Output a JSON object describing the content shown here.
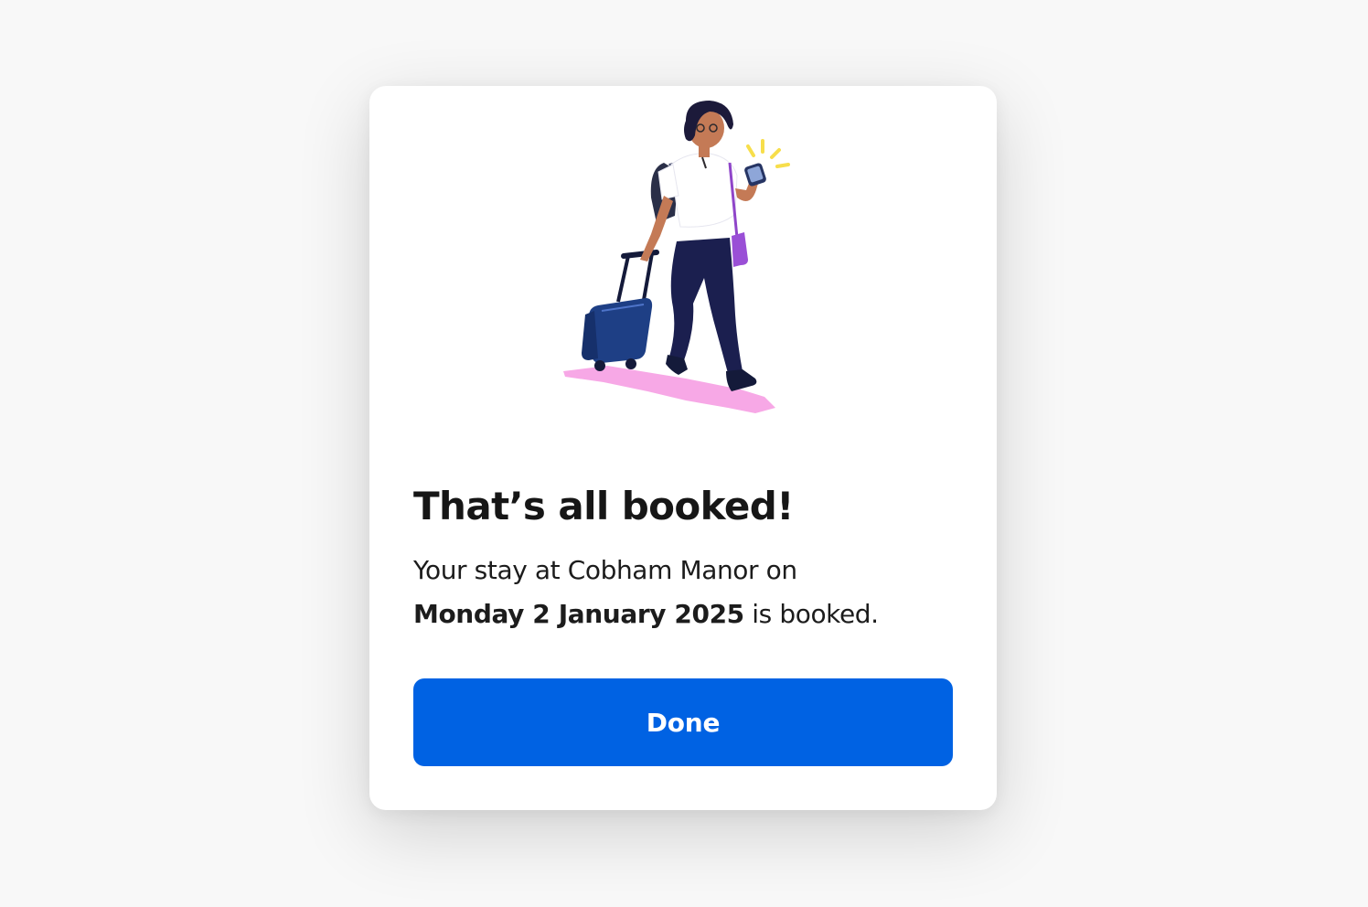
{
  "dialog": {
    "title": "That’s all booked!",
    "message_prefix": "Your stay at Cobham Manor on",
    "message_date": "Monday 2 January 2025",
    "message_suffix": " is booked.",
    "done_label": "Done",
    "illustration": "traveller-with-suitcase-illustration"
  },
  "colors": {
    "page_background": "#f8f8f8",
    "card_background": "#ffffff",
    "primary_button": "#0062e3",
    "text": "#161616"
  }
}
